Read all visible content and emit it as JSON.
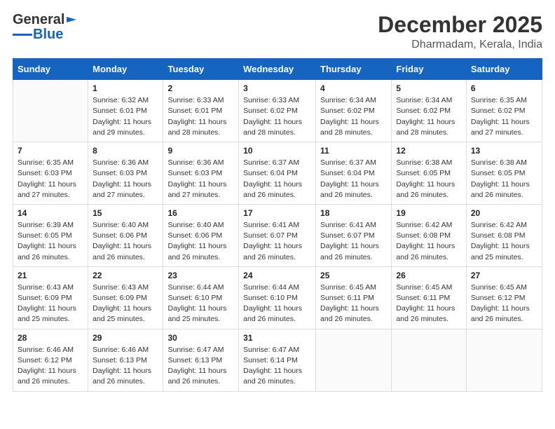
{
  "header": {
    "logo": {
      "general": "General",
      "blue": "Blue"
    },
    "title": "December 2025",
    "subtitle": "Dharmadam, Kerala, India"
  },
  "calendar": {
    "days_of_week": [
      "Sunday",
      "Monday",
      "Tuesday",
      "Wednesday",
      "Thursday",
      "Friday",
      "Saturday"
    ],
    "weeks": [
      [
        {
          "day": "",
          "sunrise": "",
          "sunset": "",
          "daylight": ""
        },
        {
          "day": "1",
          "sunrise": "Sunrise: 6:32 AM",
          "sunset": "Sunset: 6:01 PM",
          "daylight": "Daylight: 11 hours and 29 minutes."
        },
        {
          "day": "2",
          "sunrise": "Sunrise: 6:33 AM",
          "sunset": "Sunset: 6:01 PM",
          "daylight": "Daylight: 11 hours and 28 minutes."
        },
        {
          "day": "3",
          "sunrise": "Sunrise: 6:33 AM",
          "sunset": "Sunset: 6:02 PM",
          "daylight": "Daylight: 11 hours and 28 minutes."
        },
        {
          "day": "4",
          "sunrise": "Sunrise: 6:34 AM",
          "sunset": "Sunset: 6:02 PM",
          "daylight": "Daylight: 11 hours and 28 minutes."
        },
        {
          "day": "5",
          "sunrise": "Sunrise: 6:34 AM",
          "sunset": "Sunset: 6:02 PM",
          "daylight": "Daylight: 11 hours and 28 minutes."
        },
        {
          "day": "6",
          "sunrise": "Sunrise: 6:35 AM",
          "sunset": "Sunset: 6:02 PM",
          "daylight": "Daylight: 11 hours and 27 minutes."
        }
      ],
      [
        {
          "day": "7",
          "sunrise": "Sunrise: 6:35 AM",
          "sunset": "Sunset: 6:03 PM",
          "daylight": "Daylight: 11 hours and 27 minutes."
        },
        {
          "day": "8",
          "sunrise": "Sunrise: 6:36 AM",
          "sunset": "Sunset: 6:03 PM",
          "daylight": "Daylight: 11 hours and 27 minutes."
        },
        {
          "day": "9",
          "sunrise": "Sunrise: 6:36 AM",
          "sunset": "Sunset: 6:03 PM",
          "daylight": "Daylight: 11 hours and 27 minutes."
        },
        {
          "day": "10",
          "sunrise": "Sunrise: 6:37 AM",
          "sunset": "Sunset: 6:04 PM",
          "daylight": "Daylight: 11 hours and 26 minutes."
        },
        {
          "day": "11",
          "sunrise": "Sunrise: 6:37 AM",
          "sunset": "Sunset: 6:04 PM",
          "daylight": "Daylight: 11 hours and 26 minutes."
        },
        {
          "day": "12",
          "sunrise": "Sunrise: 6:38 AM",
          "sunset": "Sunset: 6:05 PM",
          "daylight": "Daylight: 11 hours and 26 minutes."
        },
        {
          "day": "13",
          "sunrise": "Sunrise: 6:38 AM",
          "sunset": "Sunset: 6:05 PM",
          "daylight": "Daylight: 11 hours and 26 minutes."
        }
      ],
      [
        {
          "day": "14",
          "sunrise": "Sunrise: 6:39 AM",
          "sunset": "Sunset: 6:05 PM",
          "daylight": "Daylight: 11 hours and 26 minutes."
        },
        {
          "day": "15",
          "sunrise": "Sunrise: 6:40 AM",
          "sunset": "Sunset: 6:06 PM",
          "daylight": "Daylight: 11 hours and 26 minutes."
        },
        {
          "day": "16",
          "sunrise": "Sunrise: 6:40 AM",
          "sunset": "Sunset: 6:06 PM",
          "daylight": "Daylight: 11 hours and 26 minutes."
        },
        {
          "day": "17",
          "sunrise": "Sunrise: 6:41 AM",
          "sunset": "Sunset: 6:07 PM",
          "daylight": "Daylight: 11 hours and 26 minutes."
        },
        {
          "day": "18",
          "sunrise": "Sunrise: 6:41 AM",
          "sunset": "Sunset: 6:07 PM",
          "daylight": "Daylight: 11 hours and 26 minutes."
        },
        {
          "day": "19",
          "sunrise": "Sunrise: 6:42 AM",
          "sunset": "Sunset: 6:08 PM",
          "daylight": "Daylight: 11 hours and 26 minutes."
        },
        {
          "day": "20",
          "sunrise": "Sunrise: 6:42 AM",
          "sunset": "Sunset: 6:08 PM",
          "daylight": "Daylight: 11 hours and 25 minutes."
        }
      ],
      [
        {
          "day": "21",
          "sunrise": "Sunrise: 6:43 AM",
          "sunset": "Sunset: 6:09 PM",
          "daylight": "Daylight: 11 hours and 25 minutes."
        },
        {
          "day": "22",
          "sunrise": "Sunrise: 6:43 AM",
          "sunset": "Sunset: 6:09 PM",
          "daylight": "Daylight: 11 hours and 25 minutes."
        },
        {
          "day": "23",
          "sunrise": "Sunrise: 6:44 AM",
          "sunset": "Sunset: 6:10 PM",
          "daylight": "Daylight: 11 hours and 25 minutes."
        },
        {
          "day": "24",
          "sunrise": "Sunrise: 6:44 AM",
          "sunset": "Sunset: 6:10 PM",
          "daylight": "Daylight: 11 hours and 26 minutes."
        },
        {
          "day": "25",
          "sunrise": "Sunrise: 6:45 AM",
          "sunset": "Sunset: 6:11 PM",
          "daylight": "Daylight: 11 hours and 26 minutes."
        },
        {
          "day": "26",
          "sunrise": "Sunrise: 6:45 AM",
          "sunset": "Sunset: 6:11 PM",
          "daylight": "Daylight: 11 hours and 26 minutes."
        },
        {
          "day": "27",
          "sunrise": "Sunrise: 6:45 AM",
          "sunset": "Sunset: 6:12 PM",
          "daylight": "Daylight: 11 hours and 26 minutes."
        }
      ],
      [
        {
          "day": "28",
          "sunrise": "Sunrise: 6:46 AM",
          "sunset": "Sunset: 6:12 PM",
          "daylight": "Daylight: 11 hours and 26 minutes."
        },
        {
          "day": "29",
          "sunrise": "Sunrise: 6:46 AM",
          "sunset": "Sunset: 6:13 PM",
          "daylight": "Daylight: 11 hours and 26 minutes."
        },
        {
          "day": "30",
          "sunrise": "Sunrise: 6:47 AM",
          "sunset": "Sunset: 6:13 PM",
          "daylight": "Daylight: 11 hours and 26 minutes."
        },
        {
          "day": "31",
          "sunrise": "Sunrise: 6:47 AM",
          "sunset": "Sunset: 6:14 PM",
          "daylight": "Daylight: 11 hours and 26 minutes."
        },
        {
          "day": "",
          "sunrise": "",
          "sunset": "",
          "daylight": ""
        },
        {
          "day": "",
          "sunrise": "",
          "sunset": "",
          "daylight": ""
        },
        {
          "day": "",
          "sunrise": "",
          "sunset": "",
          "daylight": ""
        }
      ]
    ]
  }
}
